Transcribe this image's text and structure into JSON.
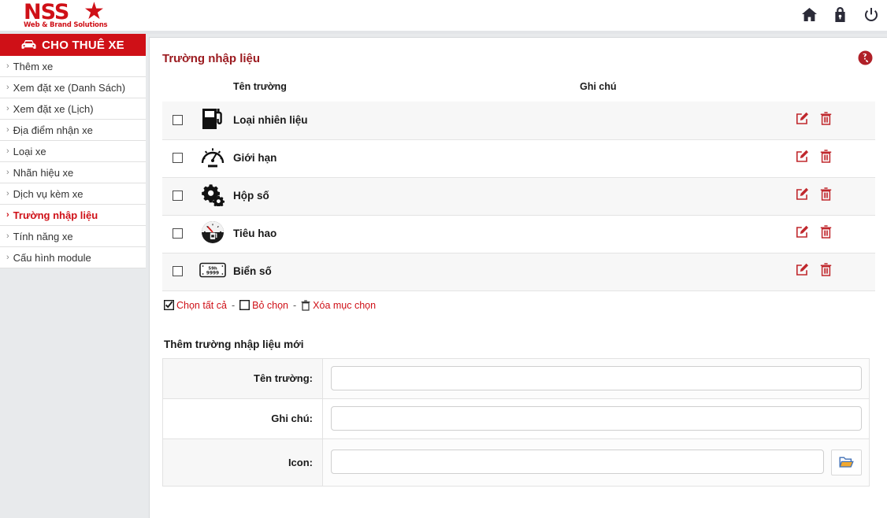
{
  "brand": {
    "name": "NSS",
    "tagline": "Web & Brand Solutions",
    "star_icon": "star-icon",
    "accent_color": "#cf1017"
  },
  "topbar": {
    "icons": [
      {
        "name": "home-icon",
        "label": "Trang chủ"
      },
      {
        "name": "lock-icon",
        "label": "Bảo mật"
      },
      {
        "name": "power-icon",
        "label": "Đăng xuất"
      }
    ]
  },
  "sidebar": {
    "header": {
      "label": "CHO THUÊ XE",
      "icon": "car-icon"
    },
    "items": [
      {
        "label": "Thêm xe",
        "active": false
      },
      {
        "label": "Xem đặt xe (Danh Sách)",
        "active": false
      },
      {
        "label": "Xem đặt xe (Lịch)",
        "active": false
      },
      {
        "label": "Địa điểm nhận xe",
        "active": false
      },
      {
        "label": "Loại xe",
        "active": false
      },
      {
        "label": "Nhãn hiệu xe",
        "active": false
      },
      {
        "label": "Dịch vụ kèm xe",
        "active": false
      },
      {
        "label": "Trường nhập liệu",
        "active": true
      },
      {
        "label": "Tính năng xe",
        "active": false
      },
      {
        "label": "Cấu hình module",
        "active": false
      }
    ]
  },
  "panel": {
    "title": "Trường nhập liệu",
    "help_icon": "help-globe-icon"
  },
  "table": {
    "headers": {
      "checkbox": "",
      "icon": "",
      "name": "Tên trường",
      "note": "Ghi chú",
      "actions": ""
    },
    "rows": [
      {
        "name": "Loại nhiên liệu",
        "note": "",
        "icon": "fuel-pump-icon",
        "checked": false
      },
      {
        "name": "Giới hạn",
        "note": "",
        "icon": "speedometer-icon",
        "checked": false
      },
      {
        "name": "Hộp số",
        "note": "",
        "icon": "gears-icon",
        "checked": false
      },
      {
        "name": "Tiêu hao",
        "note": "",
        "icon": "fuel-gauge-icon",
        "checked": false
      },
      {
        "name": "Biển số",
        "note": "",
        "icon": "license-plate-icon",
        "checked": false
      }
    ],
    "row_actions": [
      {
        "name": "edit-icon",
        "label": "Sửa"
      },
      {
        "name": "delete-icon",
        "label": "Xóa"
      }
    ]
  },
  "bulk_actions": {
    "select_all": "Chọn tất cả",
    "deselect": "Bỏ chọn",
    "delete_selected": "Xóa mục chọn",
    "separator": "-"
  },
  "form": {
    "title": "Thêm trường nhập liệu mới",
    "fields": [
      {
        "label": "Tên trường:",
        "value": "",
        "placeholder": ""
      },
      {
        "label": "Ghi chú:",
        "value": "",
        "placeholder": ""
      },
      {
        "label": "Icon:",
        "value": "",
        "placeholder": ""
      }
    ],
    "browse_icon": "folder-open-icon"
  }
}
